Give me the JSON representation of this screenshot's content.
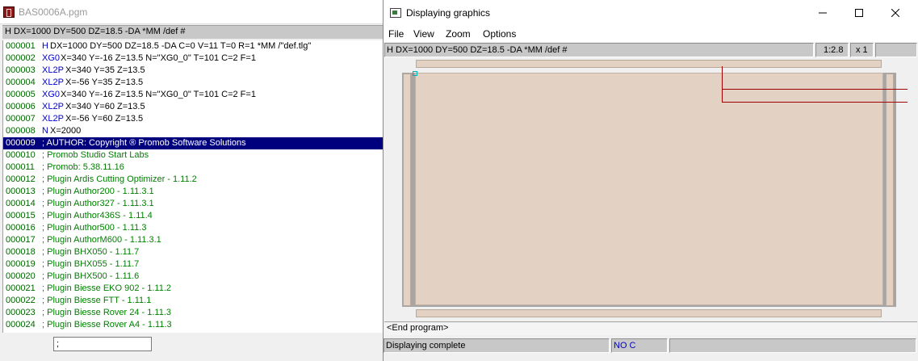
{
  "editor": {
    "title": "BAS0006A.pgm",
    "header": "H DX=1000 DY=500 DZ=18.5 -DA *MM /def #",
    "command_input": ";",
    "lines": [
      {
        "num": "000001",
        "kw": "H",
        "text": "DX=1000 DY=500 DZ=18.5 -DA C=0 V=11 T=0 R=1 *MM /\"def.tlg\"",
        "type": "code"
      },
      {
        "num": "000002",
        "kw": "XG0",
        "text": "X=340 Y=-16 Z=13.5 N=\"XG0_0\" T=101 C=2 F=1",
        "type": "code"
      },
      {
        "num": "000003",
        "kw": "XL2P",
        "text": "X=340 Y=35 Z=13.5",
        "type": "code"
      },
      {
        "num": "000004",
        "kw": "XL2P",
        "text": "X=-56 Y=35 Z=13.5",
        "type": "code"
      },
      {
        "num": "000005",
        "kw": "XG0",
        "text": "X=340 Y=-16 Z=13.5 N=\"XG0_0\" T=101 C=2 F=1",
        "type": "code"
      },
      {
        "num": "000006",
        "kw": "XL2P",
        "text": "X=340 Y=60 Z=13.5",
        "type": "code"
      },
      {
        "num": "000007",
        "kw": "XL2P",
        "text": "X=-56 Y=60 Z=13.5",
        "type": "code"
      },
      {
        "num": "000008",
        "kw": "N",
        "text": "X=2000",
        "type": "code"
      },
      {
        "num": "000009",
        "kw": "",
        "text": "; AUTHOR: Copyright ® Promob Software Solutions",
        "type": "selected"
      },
      {
        "num": "000010",
        "kw": "",
        "text": "; Promob Studio Start Labs",
        "type": "comment"
      },
      {
        "num": "000011",
        "kw": "",
        "text": "; Promob: 5.38.11.16",
        "type": "comment"
      },
      {
        "num": "000012",
        "kw": "",
        "text": "; Plugin Ardis Cutting Optimizer - 1.11.2",
        "type": "comment"
      },
      {
        "num": "000013",
        "kw": "",
        "text": "; Plugin Author200 - 1.11.3.1",
        "type": "comment"
      },
      {
        "num": "000014",
        "kw": "",
        "text": "; Plugin Author327 - 1.11.3.1",
        "type": "comment"
      },
      {
        "num": "000015",
        "kw": "",
        "text": "; Plugin Author436S - 1.11.4",
        "type": "comment"
      },
      {
        "num": "000016",
        "kw": "",
        "text": "; Plugin Author500 - 1.11.3",
        "type": "comment"
      },
      {
        "num": "000017",
        "kw": "",
        "text": "; Plugin AuthorM600 - 1.11.3.1",
        "type": "comment"
      },
      {
        "num": "000018",
        "kw": "",
        "text": "; Plugin BHX050 - 1.11.7",
        "type": "comment"
      },
      {
        "num": "000019",
        "kw": "",
        "text": "; Plugin BHX055 - 1.11.7",
        "type": "comment"
      },
      {
        "num": "000020",
        "kw": "",
        "text": "; Plugin BHX500 - 1.11.6",
        "type": "comment"
      },
      {
        "num": "000021",
        "kw": "",
        "text": "; Plugin Biesse EKO 902 - 1.11.2",
        "type": "comment"
      },
      {
        "num": "000022",
        "kw": "",
        "text": "; Plugin Biesse FTT - 1.11.1",
        "type": "comment"
      },
      {
        "num": "000023",
        "kw": "",
        "text": "; Plugin Biesse Rover 24 - 1.11.3",
        "type": "comment"
      },
      {
        "num": "000024",
        "kw": "",
        "text": "; Plugin Biesse Rover A4 - 1.11.3",
        "type": "comment"
      }
    ]
  },
  "graphics": {
    "title": "Displaying graphics",
    "menu": {
      "file": "File",
      "view": "View",
      "zoom": "Zoom",
      "options": "Options"
    },
    "header": "H DX=1000 DY=500 DZ=18.5 -DA *MM /def #",
    "scale": "1:2.8",
    "multiplier": "x 1",
    "end_program": "<End program>",
    "status": {
      "message": "Displaying complete",
      "mode": "NO C"
    },
    "colors": {
      "panel": "#e3d1c3",
      "toolpath": "#a00000",
      "origin": "#00b0b0",
      "selection": "#00007f"
    }
  }
}
